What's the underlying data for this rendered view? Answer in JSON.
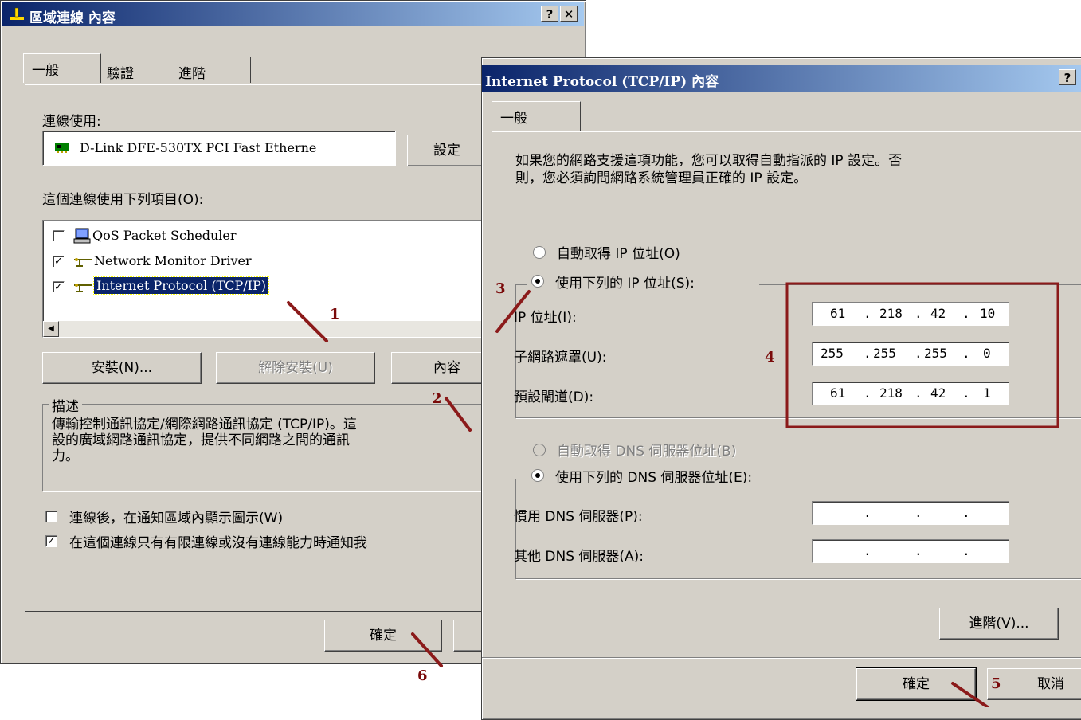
{
  "left_window": {
    "title": "區域連線 內容",
    "title_buttons": [
      "?",
      "✕"
    ],
    "tabs": [
      "一般",
      "驗證",
      "進階"
    ],
    "connect_using_label": "連線使用:",
    "adapter_name": "D-Link DFE-530TX PCI Fast Etherne",
    "configure_button": "設定",
    "items_label": "這個連線使用下列項目(O):",
    "items": [
      {
        "label": "QoS Packet Scheduler",
        "checked": false,
        "icon": "scheduler-icon"
      },
      {
        "label": "Network Monitor Driver",
        "checked": true,
        "icon": "network-protocol-icon"
      },
      {
        "label": "Internet Protocol (TCP/IP)",
        "checked": true,
        "selected": true,
        "icon": "network-protocol-icon"
      }
    ],
    "install_button": "安裝(N)...",
    "uninstall_button": "解除安裝(U)",
    "properties_button": "內容",
    "description_title": "描述",
    "description_text": "傳輸控制通訊協定/網際網路通訊協定 (TCP/IP)。這個預設的廣域網路通訊協定，提供不同網路之間的通訊能力。",
    "description_lines": [
      "傳輸控制通訊協定/網際網路通訊協定 (TCP/IP)。這",
      "設的廣域網路通訊協定，提供不同網路之間的通訊",
      "力。"
    ],
    "show_icon_label": "連線後，在通知區域內顯示圖示(W)",
    "show_icon_checked": false,
    "notify_label": "在這個連線只有有限連線或沒有連線能力時通知我",
    "notify_checked": true,
    "ok_button": "確定"
  },
  "right_window": {
    "title": "Internet Protocol (TCP/IP) 內容",
    "help_button": "?",
    "tab": "一般",
    "intro_lines": [
      "如果您的網路支援這項功能，您可以取得自動指派的 IP 設定。否",
      "則，您必須詢問網路系統管理員正確的 IP 設定。"
    ],
    "auto_ip_label": "自動取得 IP 位址(O)",
    "use_ip_label": "使用下列的 IP 位址(S):",
    "ip_mode": "manual",
    "ip_label": "IP 位址(I):",
    "ip_value": [
      "61",
      "218",
      "42",
      "10"
    ],
    "subnet_label": "子網路遮罩(U):",
    "subnet_value": [
      "255",
      "255",
      "255",
      "0"
    ],
    "gateway_label": "預設閘道(D):",
    "gateway_value": [
      "61",
      "218",
      "42",
      "1"
    ],
    "auto_dns_label": "自動取得 DNS 伺服器位址(B)",
    "use_dns_label": "使用下列的 DNS 伺服器位址(E):",
    "dns_mode": "manual",
    "preferred_dns_label": "慣用 DNS 伺服器(P):",
    "alternate_dns_label": "其他 DNS 伺服器(A):",
    "advanced_button": "進階(V)...",
    "ok_button": "確定",
    "cancel_button": "取消"
  },
  "annotations": [
    "1",
    "2",
    "3",
    "4",
    "5",
    "6"
  ],
  "colors": {
    "title_start": "#0a246a",
    "title_end": "#a6caf0",
    "annotation": "#8b1a1a",
    "dialog_bg": "#d4d0c8",
    "selection": "#0a246a"
  }
}
